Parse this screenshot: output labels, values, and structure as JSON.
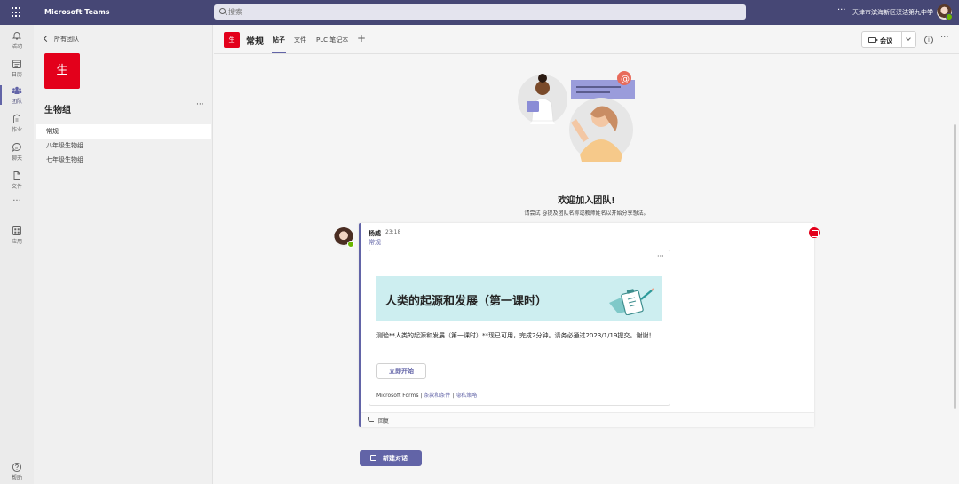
{
  "app": {
    "title": "Microsoft Teams",
    "org": "天津市滨海新区汉沽第九中学"
  },
  "search": {
    "placeholder": "搜索"
  },
  "rail": {
    "items": [
      {
        "label": "活动",
        "icon": "bell-icon"
      },
      {
        "label": "日历",
        "icon": "calendar-icon"
      },
      {
        "label": "团队",
        "icon": "teams-icon"
      },
      {
        "label": "作业",
        "icon": "assignments-icon"
      },
      {
        "label": "聊天",
        "icon": "chat-icon"
      },
      {
        "label": "文件",
        "icon": "file-icon"
      },
      {
        "label": "应用",
        "icon": "apps-icon"
      },
      {
        "label": "帮助",
        "icon": "help-icon"
      }
    ],
    "more": "···"
  },
  "sidebar": {
    "back_label": "所有团队",
    "team_avatar": "生",
    "team_name": "生物组",
    "more": "···",
    "channels": [
      {
        "label": "常规"
      },
      {
        "label": "八年级生物组"
      },
      {
        "label": "七年级生物组"
      }
    ]
  },
  "header": {
    "avatar": "生",
    "title": "常规",
    "tabs": [
      {
        "label": "帖子"
      },
      {
        "label": "文件"
      },
      {
        "label": "PLC 笔记本"
      }
    ],
    "add": "+",
    "meet_label": "会议",
    "more": "···",
    "info": "i"
  },
  "welcome": {
    "title": "欢迎加入团队!",
    "subtitle": "请尝试 @提及团队名称或教师姓名以开始分享想法。"
  },
  "post": {
    "author": "杨威",
    "time": "23:18",
    "channel": "常规",
    "card": {
      "more": "···",
      "banner_title": "人类的起源和发展（第一课时）",
      "text": "测验**人类的起源和发展（第一课时）**现已可用，完成2分钟。请务必通过2023/1/19提交。谢谢！",
      "button": "立即开始",
      "footer_prefix": "Microsoft Forms | ",
      "footer_terms": "条款和条件",
      "footer_sep": " | ",
      "footer_privacy": "隐私策略"
    },
    "reply": "回复"
  },
  "new_conversation": "新建对话",
  "colors": {
    "brand": "#464775",
    "accent": "#6264a7",
    "team": "#e3001b",
    "banner": "#cdeef0"
  }
}
